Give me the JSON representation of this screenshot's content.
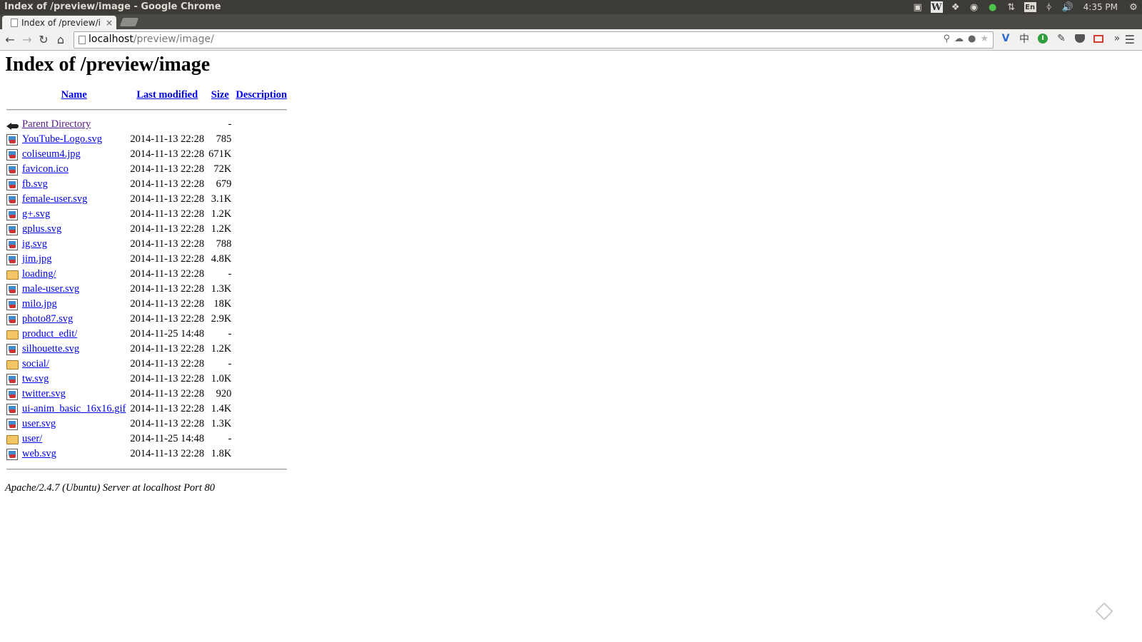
{
  "os_panel": {
    "window_title": "Index of /preview/image - Google Chrome",
    "tray": [
      "skype-icon",
      "w-icon",
      "dropbox-icon",
      "chrome-icon",
      "leaf-icon",
      "network-icon",
      "bluetooth-icon",
      "volume-icon"
    ],
    "keyboard_layout": "En",
    "clock": "4:35 PM"
  },
  "browser": {
    "tab_title": "Index of /preview/in",
    "tab_close": "×",
    "url_host": "localhost",
    "url_path": "/preview/image/",
    "extensions": [
      "v-icon",
      "zhong-icon",
      "green-circle-icon",
      "pen-icon",
      "pocket-icon",
      "gmail-icon"
    ],
    "overflow": "»"
  },
  "page": {
    "heading": "Index of /preview/image",
    "columns": {
      "name": "Name",
      "last_modified": "Last modified",
      "size": "Size",
      "description": "Description"
    },
    "parent": {
      "name": "Parent Directory",
      "modified": "",
      "size": "-"
    },
    "entries": [
      {
        "icon": "image",
        "name": "YouTube-Logo.svg",
        "modified": "2014-11-13 22:28",
        "size": "785"
      },
      {
        "icon": "image",
        "name": "coliseum4.jpg",
        "modified": "2014-11-13 22:28",
        "size": "671K"
      },
      {
        "icon": "image",
        "name": "favicon.ico",
        "modified": "2014-11-13 22:28",
        "size": "72K"
      },
      {
        "icon": "image",
        "name": "fb.svg",
        "modified": "2014-11-13 22:28",
        "size": "679"
      },
      {
        "icon": "image",
        "name": "female-user.svg",
        "modified": "2014-11-13 22:28",
        "size": "3.1K"
      },
      {
        "icon": "image",
        "name": "g+.svg",
        "modified": "2014-11-13 22:28",
        "size": "1.2K"
      },
      {
        "icon": "image",
        "name": "gplus.svg",
        "modified": "2014-11-13 22:28",
        "size": "1.2K"
      },
      {
        "icon": "image",
        "name": "ig.svg",
        "modified": "2014-11-13 22:28",
        "size": "788"
      },
      {
        "icon": "image",
        "name": "jim.jpg",
        "modified": "2014-11-13 22:28",
        "size": "4.8K"
      },
      {
        "icon": "folder",
        "name": "loading/",
        "modified": "2014-11-13 22:28",
        "size": "-"
      },
      {
        "icon": "image",
        "name": "male-user.svg",
        "modified": "2014-11-13 22:28",
        "size": "1.3K"
      },
      {
        "icon": "image",
        "name": "milo.jpg",
        "modified": "2014-11-13 22:28",
        "size": "18K"
      },
      {
        "icon": "image",
        "name": "photo87.svg",
        "modified": "2014-11-13 22:28",
        "size": "2.9K"
      },
      {
        "icon": "folder",
        "name": "product_edit/",
        "modified": "2014-11-25 14:48",
        "size": "-"
      },
      {
        "icon": "image",
        "name": "silhouette.svg",
        "modified": "2014-11-13 22:28",
        "size": "1.2K"
      },
      {
        "icon": "folder",
        "name": "social/",
        "modified": "2014-11-13 22:28",
        "size": "-"
      },
      {
        "icon": "image",
        "name": "tw.svg",
        "modified": "2014-11-13 22:28",
        "size": "1.0K"
      },
      {
        "icon": "image",
        "name": "twitter.svg",
        "modified": "2014-11-13 22:28",
        "size": "920"
      },
      {
        "icon": "image",
        "name": "ui-anim_basic_16x16.gif",
        "modified": "2014-11-13 22:28",
        "size": "1.4K"
      },
      {
        "icon": "image",
        "name": "user.svg",
        "modified": "2014-11-13 22:28",
        "size": "1.3K"
      },
      {
        "icon": "folder",
        "name": "user/",
        "modified": "2014-11-25 14:48",
        "size": "-"
      },
      {
        "icon": "image",
        "name": "web.svg",
        "modified": "2014-11-13 22:28",
        "size": "1.8K"
      }
    ],
    "footer": "Apache/2.4.7 (Ubuntu) Server at localhost Port 80"
  },
  "colors": {
    "link": "#0000ee",
    "visited_link": "#551a8b",
    "os_panel_bg": "#3c3b37",
    "toolbar_bg": "#f2f1f0"
  }
}
